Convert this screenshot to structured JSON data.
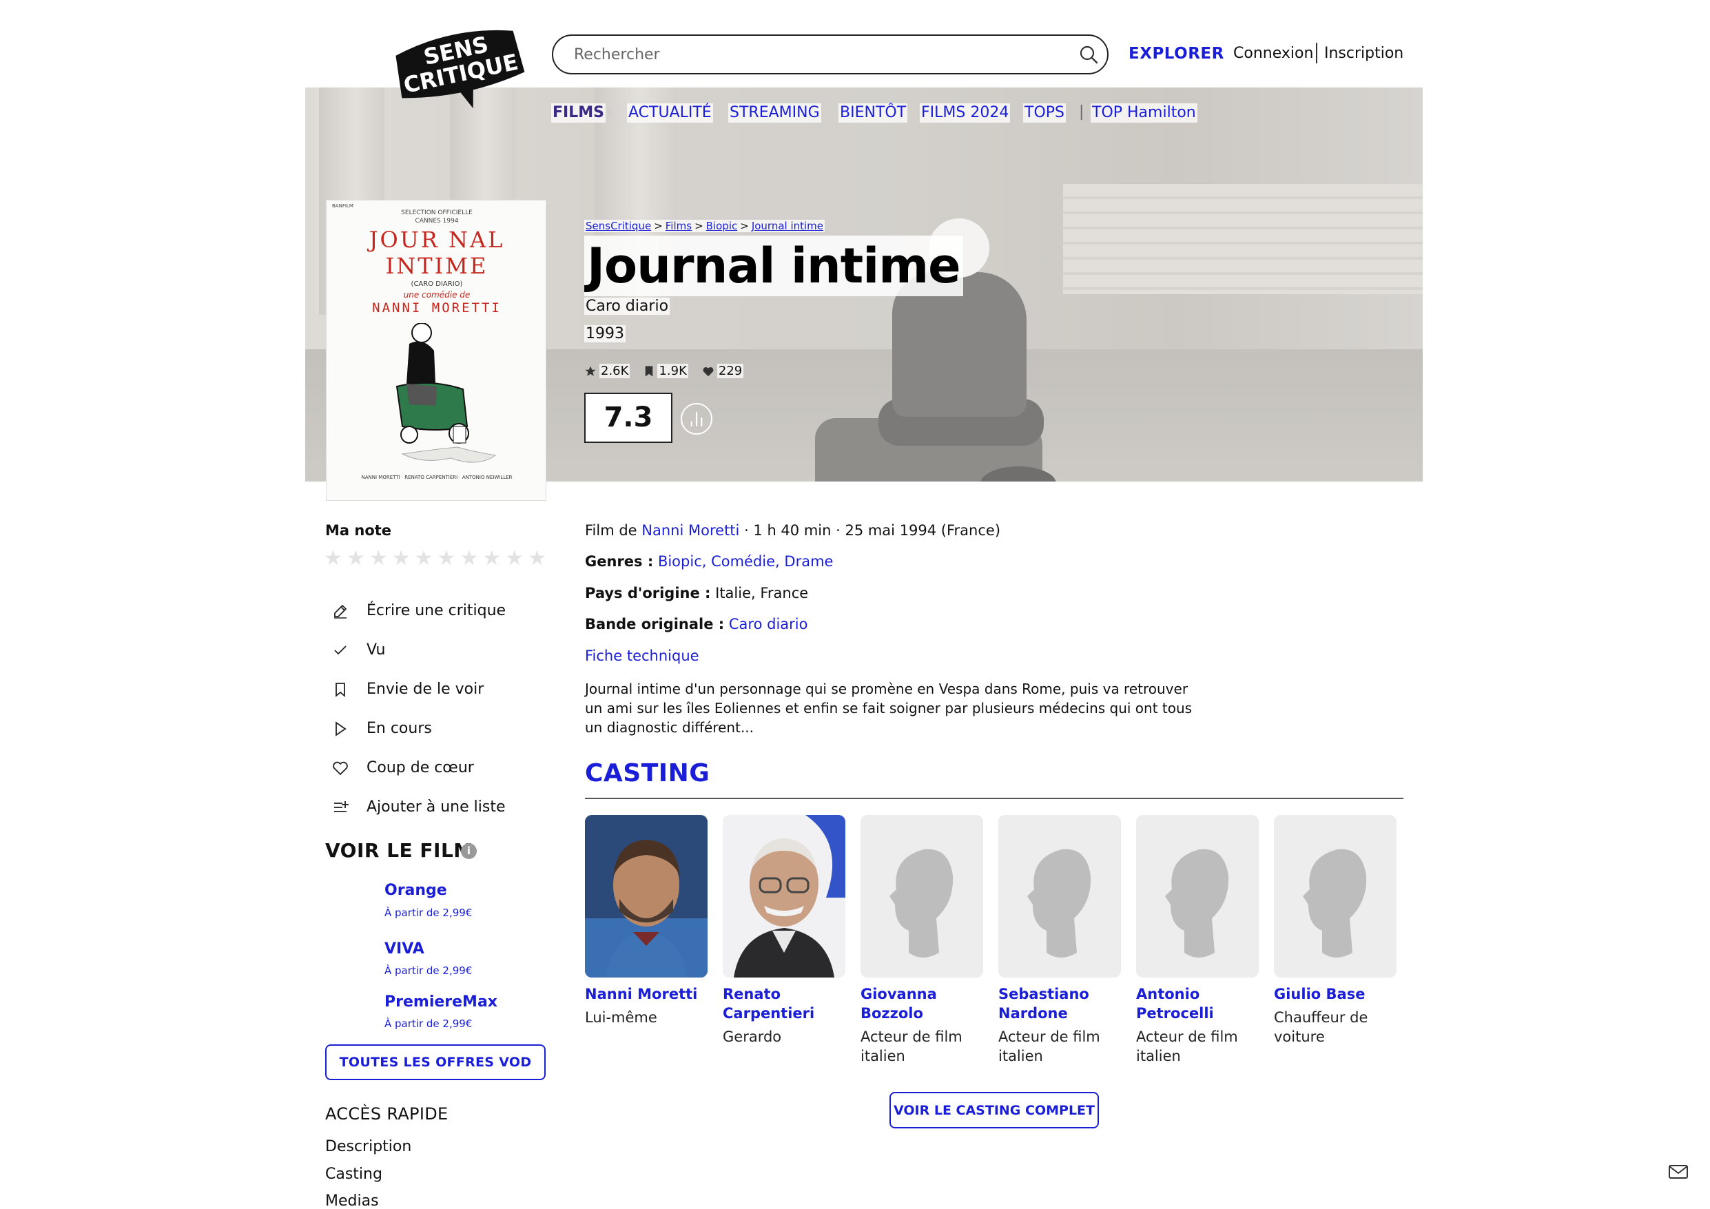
{
  "header": {
    "logo_text": [
      "SENS",
      "CRITIQUE"
    ],
    "search_placeholder": "Rechercher",
    "explorer": "EXPLORER",
    "connexion": "Connexion",
    "inscription": "Inscription"
  },
  "nav": {
    "films": "FILMS",
    "chevron": "›",
    "items": [
      "ACTUALITÉ",
      "STREAMING",
      "BIENTÔT",
      "FILMS 2024",
      "TOPS"
    ],
    "pipe": "|",
    "top_special": "TOP Hamilton"
  },
  "poster": {
    "top_left": "BANFILM",
    "selection": [
      "SELECTION OFFICIELLE",
      "CANNES 1994"
    ],
    "title_lines": [
      "JOUR NAL",
      "INTIME"
    ],
    "subtitle": "(CARO DIARIO)",
    "une_comedie": "une comédie de",
    "director": "NANNI MORETTI",
    "credits": "NANNI MORETTI · RENATO CARPENTIERI · ANTONIO NEIWILLER"
  },
  "film": {
    "breadcrumb": [
      "SensCritique",
      "Films",
      "Biopic",
      "Journal intime"
    ],
    "breadcrumb_sep": ">",
    "title": "Journal intime",
    "original_title": "Caro diario",
    "year": "1993",
    "stats": {
      "ratings": "2.6K",
      "wishlist": "1.9K",
      "likes": "229"
    },
    "rating": "7.3"
  },
  "sidebar": {
    "ma_note": "Ma note",
    "stars_count": 10,
    "actions": [
      {
        "label": "Écrire une critique",
        "icon": "pencil-icon"
      },
      {
        "label": "Vu",
        "icon": "check-icon"
      },
      {
        "label": "Envie de le voir",
        "icon": "bookmark-icon"
      },
      {
        "label": "En cours",
        "icon": "play-icon"
      },
      {
        "label": "Coup de cœur",
        "icon": "heart-icon"
      },
      {
        "label": "Ajouter à une liste",
        "icon": "list-add-icon"
      }
    ],
    "voir_le_film": "VOIR LE FILM",
    "info": "i",
    "vod": [
      {
        "name": "Orange",
        "price": "À partir de 2,99€"
      },
      {
        "name": "VIVA",
        "price": "À partir de 2,99€"
      },
      {
        "name": "PremiereMax",
        "price": "À partir de 2,99€"
      }
    ],
    "all_vod_button": "TOUTES LES OFFRES VOD",
    "acces_rapide": "ACCÈS RAPIDE",
    "quick_links": [
      "Description",
      "Casting",
      "Medias"
    ]
  },
  "details": {
    "film_de_prefix": "Film de",
    "director": "Nanni Moretti",
    "film_de_suffix": "· 1 h 40 min · 25 mai 1994 (France)",
    "genres_label": "Genres :",
    "genres": "Biopic, Comédie, Drame",
    "pays_label": "Pays d'origine :",
    "pays": "Italie, France",
    "bande_label": "Bande originale :",
    "bande": "Caro diario",
    "fiche": "Fiche technique",
    "synopsis": "Journal intime d'un personnage qui se promène en Vespa dans Rome, puis va retrouver un ami sur les îles Eoliennes et enfin se fait soigner par plusieurs médecins qui ont tous un diagnostic différent..."
  },
  "casting": {
    "heading": "CASTING",
    "members": [
      {
        "name": "Nanni Moretti",
        "role": "Lui-même",
        "photo": "photo"
      },
      {
        "name": "Renato Carpentieri",
        "role": "Gerardo",
        "photo": "photo"
      },
      {
        "name": "Giovanna Bozzolo",
        "role": "Acteur de film italien",
        "photo": "placeholder"
      },
      {
        "name": "Sebastiano Nardone",
        "role": "Acteur de film italien",
        "photo": "placeholder"
      },
      {
        "name": "Antonio Petrocelli",
        "role": "Acteur de film italien",
        "photo": "placeholder"
      },
      {
        "name": "Giulio Base",
        "role": "Chauffeur de voiture",
        "photo": "placeholder"
      }
    ],
    "button": "VOIR LE CASTING COMPLET"
  },
  "colors": {
    "accent": "#1a1ed6",
    "films_nav": "#3a2a88",
    "poster_red": "#c7261f"
  }
}
